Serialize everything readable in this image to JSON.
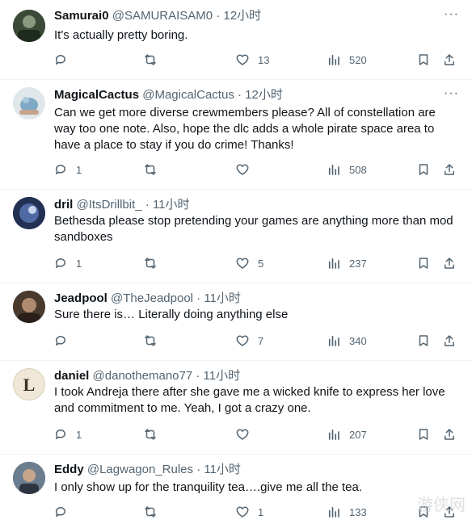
{
  "tweets": [
    {
      "name": "Samurai0",
      "handle": "@SAMURAISAM0",
      "sep": "·",
      "time": "12小时",
      "text": "It's actually pretty boring.",
      "reply": "",
      "retweet": "",
      "like": "13",
      "views": "520"
    },
    {
      "name": "MagicalCactus",
      "handle": "@MagicalCactus",
      "sep": "·",
      "time": "12小时",
      "text": "Can we get more diverse crewmembers please? All of constellation are way too one note. Also, hope the dlc adds a whole pirate space area to have a place to stay if you do crime! Thanks!",
      "reply": "1",
      "retweet": "",
      "like": "",
      "views": "508"
    },
    {
      "name": "dril",
      "handle": "@ItsDrillbit_",
      "sep": "·",
      "time": "11小时",
      "text": "Bethesda please stop pretending your games are anything more than mod sandboxes",
      "reply": "1",
      "retweet": "",
      "like": "5",
      "views": "237"
    },
    {
      "name": "Jeadpool",
      "handle": "@TheJeadpool",
      "sep": "·",
      "time": "11小时",
      "text": "Sure there is… Literally doing anything else",
      "reply": "",
      "retweet": "",
      "like": "7",
      "views": "340"
    },
    {
      "name": "daniel",
      "handle": "@danothemano77",
      "sep": "·",
      "time": "11小时",
      "text": "I took Andreja there after she gave me a wicked knife to express her love and commitment to me. Yeah, I got a crazy one.",
      "reply": "1",
      "retweet": "",
      "like": "",
      "views": "207"
    },
    {
      "name": "Eddy",
      "handle": "@Lagwagon_Rules",
      "sep": "·",
      "time": "11小时",
      "text": "I only show up for the tranquility tea….give me all the tea.",
      "reply": "",
      "retweet": "",
      "like": "1",
      "views": "133"
    }
  ],
  "avatar_letter_daniel": "L",
  "watermark": "游侠网",
  "colors": {
    "text": "#0f1419",
    "muted": "#536471",
    "divider": "#eff3f4"
  }
}
